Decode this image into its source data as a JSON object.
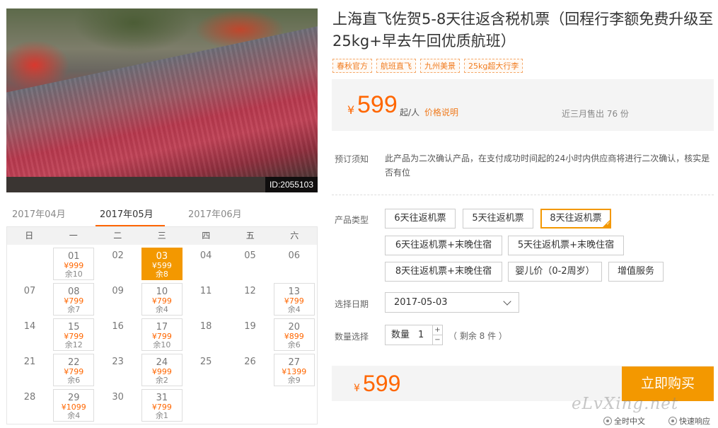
{
  "photo": {
    "id_label": "ID:2055103"
  },
  "product": {
    "title": "上海直飞佐贺5-8天往返含税机票（回程行李额免费升级至25kg+早去午回优质航班）",
    "tags": [
      "春秋官方",
      "航班直飞",
      "九州美景",
      "25kg超大行李"
    ]
  },
  "price": {
    "currency": "¥",
    "value": "599",
    "unit": "起/人",
    "explain": "价格说明",
    "sold": "近三月售出 76 份"
  },
  "notice": {
    "label": "预订须知",
    "text": "此产品为二次确认产品，在支付成功时间起的24小时内供应商将进行二次确认，核实是否有位"
  },
  "product_type": {
    "label": "产品类型",
    "options": [
      "6天往返机票",
      "5天往返机票",
      "8天往返机票",
      "6天往返机票+末晚住宿",
      "5天往返机票+末晚住宿",
      "8天往返机票+末晚住宿",
      "婴儿价（0-2周岁）",
      "增值服务"
    ],
    "selected_index": 2
  },
  "date_select": {
    "label": "选择日期",
    "value": "2017-05-03"
  },
  "quantity": {
    "label": "数量选择",
    "field_label": "数量",
    "value": "1",
    "plus": "+",
    "minus": "−",
    "remain": "（ 剩余 8 件 ）"
  },
  "total": {
    "currency": "¥",
    "value": "599"
  },
  "buy_button": "立即购买",
  "calendar": {
    "months": [
      "2017年04月",
      "2017年05月",
      "2017年06月"
    ],
    "active_month_index": 1,
    "weekdays": [
      "日",
      "一",
      "二",
      "三",
      "四",
      "五",
      "六"
    ],
    "weeks": [
      [
        null,
        {
          "d": "01",
          "p": "¥999",
          "r": "余10"
        },
        {
          "d": "02"
        },
        {
          "d": "03",
          "p": "¥599",
          "r": "余8",
          "sel": true
        },
        {
          "d": "04"
        },
        {
          "d": "05"
        },
        {
          "d": "06"
        }
      ],
      [
        {
          "d": "07"
        },
        {
          "d": "08",
          "p": "¥799",
          "r": "余7"
        },
        {
          "d": "09"
        },
        {
          "d": "10",
          "p": "¥799",
          "r": "余4"
        },
        {
          "d": "11"
        },
        {
          "d": "12"
        },
        {
          "d": "13",
          "p": "¥799",
          "r": "余4"
        }
      ],
      [
        {
          "d": "14"
        },
        {
          "d": "15",
          "p": "¥799",
          "r": "余12"
        },
        {
          "d": "16"
        },
        {
          "d": "17",
          "p": "¥799",
          "r": "余10"
        },
        {
          "d": "18"
        },
        {
          "d": "19"
        },
        {
          "d": "20",
          "p": "¥899",
          "r": "余6"
        }
      ],
      [
        {
          "d": "21"
        },
        {
          "d": "22",
          "p": "¥799",
          "r": "余6"
        },
        {
          "d": "23"
        },
        {
          "d": "24",
          "p": "¥999",
          "r": "余2"
        },
        {
          "d": "25"
        },
        {
          "d": "26"
        },
        {
          "d": "27",
          "p": "¥1399",
          "r": "余9"
        }
      ],
      [
        {
          "d": "28"
        },
        {
          "d": "29",
          "p": "¥1099",
          "r": "余4"
        },
        {
          "d": "30"
        },
        {
          "d": "31",
          "p": "¥799",
          "r": "余1"
        },
        null,
        null,
        null
      ]
    ]
  },
  "watermark": "eLvXing.net",
  "footer": {
    "item1": "全时中文",
    "item2": "快速响应"
  }
}
